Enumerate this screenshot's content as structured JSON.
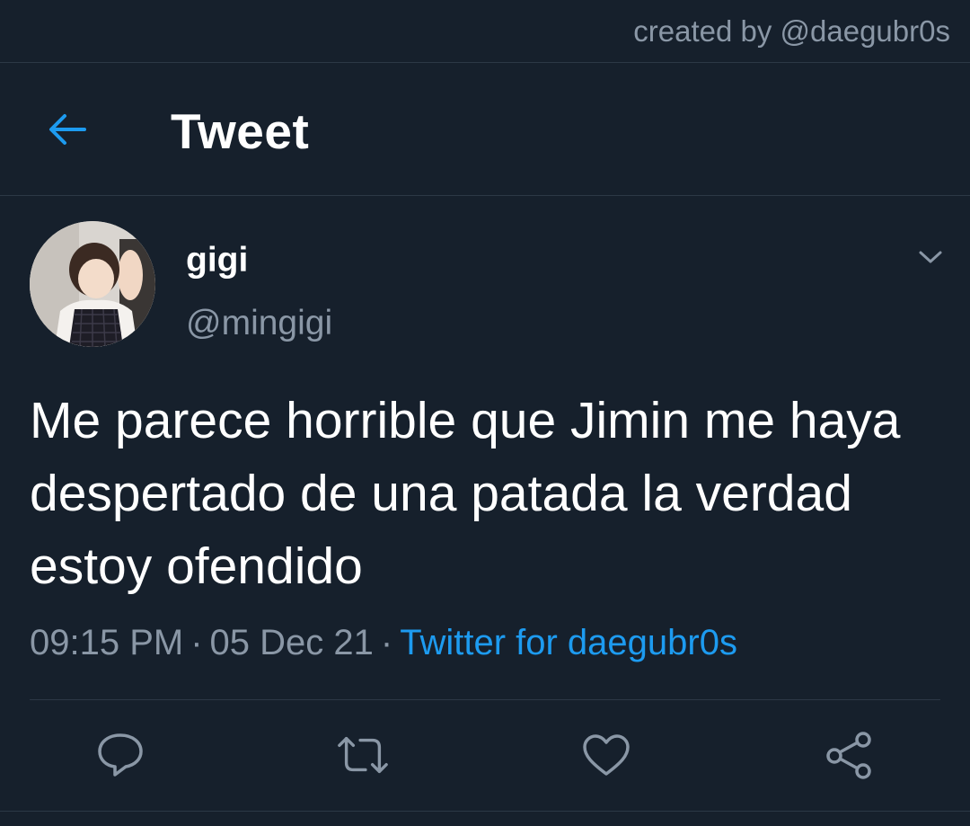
{
  "credit": "created by @daegubr0s",
  "header": {
    "title": "Tweet",
    "back_icon": "arrow-left-icon"
  },
  "tweet": {
    "display_name": "gigi",
    "handle": "@mingigi",
    "text": "Me parece horrible que Jimin me haya despertado de una patada la verdad estoy ofendido",
    "time": "09:15 PM",
    "separator": "·",
    "date": "05 Dec 21",
    "source": "Twitter for daegubr0s"
  },
  "actions": [
    "reply-icon",
    "retweet-icon",
    "like-icon",
    "share-icon"
  ],
  "colors": {
    "background": "#16202c",
    "accent": "#1d9bf0",
    "muted_text": "#8a97a6",
    "divider": "#2c3846"
  }
}
